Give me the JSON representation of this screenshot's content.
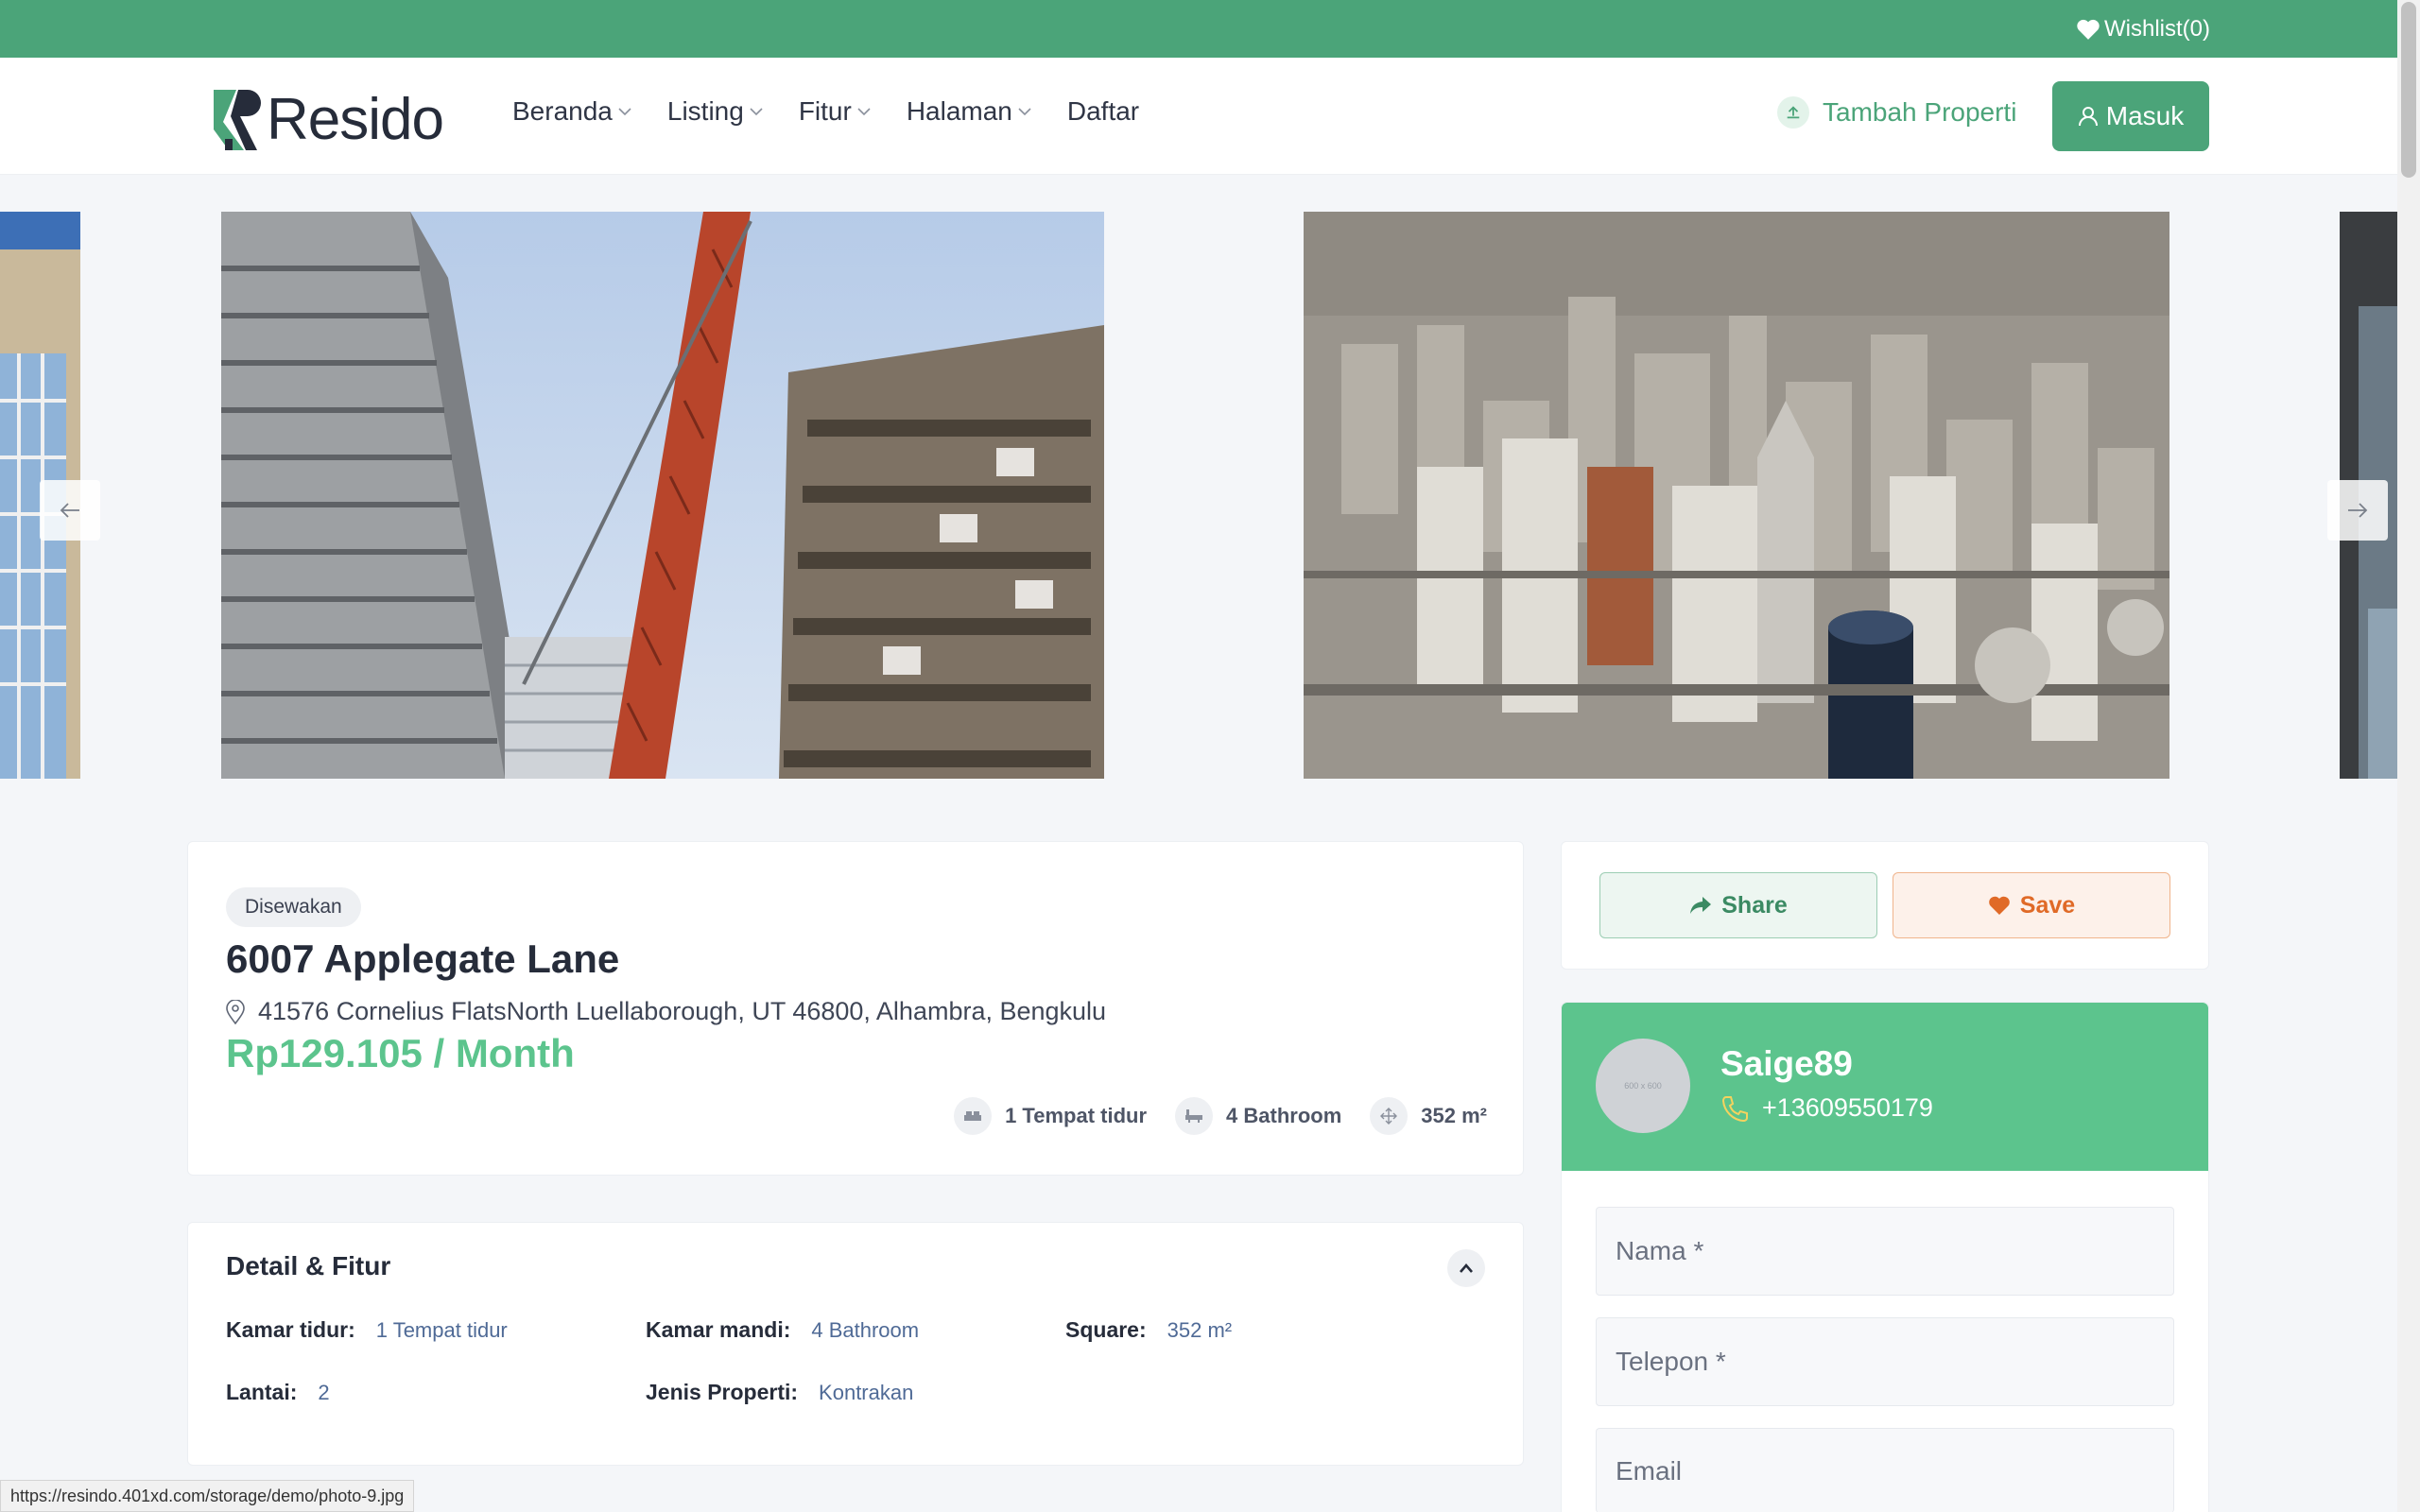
{
  "topbar": {
    "wishlist_label": "Wishlist(0)"
  },
  "header": {
    "brand": "Resido",
    "nav": [
      {
        "label": "Beranda",
        "has_dropdown": true
      },
      {
        "label": "Listing",
        "has_dropdown": true
      },
      {
        "label": "Fitur",
        "has_dropdown": true
      },
      {
        "label": "Halaman",
        "has_dropdown": true
      },
      {
        "label": "Daftar",
        "has_dropdown": false
      }
    ],
    "add_property_label": "Tambah Properti",
    "login_label": "Masuk"
  },
  "property": {
    "status_tag": "Disewakan",
    "title": "6007 Applegate Lane",
    "address": "41576 Cornelius FlatsNorth Luellaborough, UT 46800, Alhambra, Bengkulu",
    "price": "Rp129.105 / Month",
    "specs": {
      "bedrooms": "1 Tempat tidur",
      "bathrooms": "4 Bathroom",
      "area": "352 m²"
    }
  },
  "details": {
    "title": "Detail & Fitur",
    "items": [
      {
        "key": "Kamar tidur:",
        "value": "1 Tempat tidur"
      },
      {
        "key": "Kamar mandi:",
        "value": "4 Bathroom"
      },
      {
        "key": "Square:",
        "value": "352 m²"
      },
      {
        "key": "Lantai:",
        "value": "2"
      },
      {
        "key": "Jenis Properti:",
        "value": "Kontrakan"
      }
    ]
  },
  "actions": {
    "share_label": "Share",
    "save_label": "Save"
  },
  "agent": {
    "name": "Saige89",
    "phone": "+13609550179",
    "avatar_text": "600 x 600"
  },
  "contact_form": {
    "name_placeholder": "Nama *",
    "phone_placeholder": "Telepon *",
    "email_placeholder": "Email"
  },
  "status_url": "https://resindo.401xd.com/storage/demo/photo-9.jpg",
  "colors": {
    "brand_green": "#4ba479",
    "price_green": "#5cc48d",
    "save_orange": "#e06a27"
  }
}
